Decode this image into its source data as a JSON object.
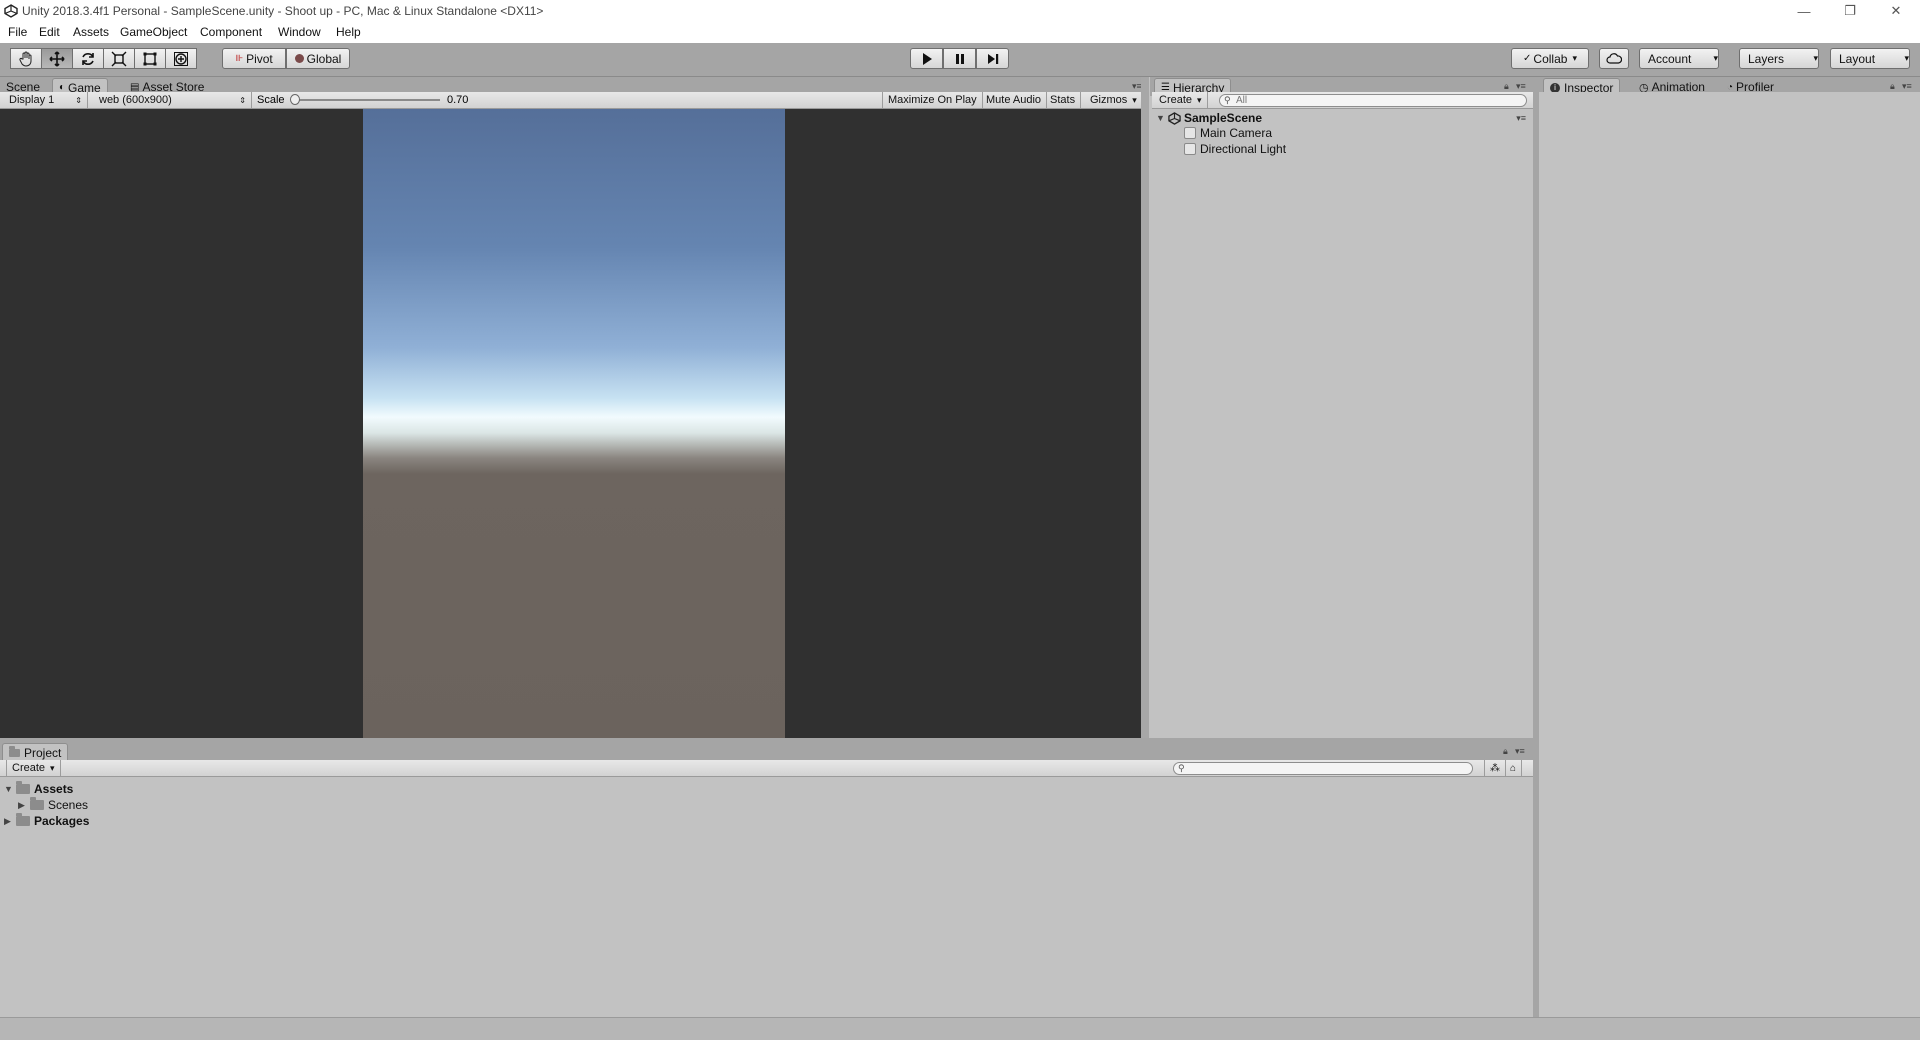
{
  "window": {
    "title": "Unity 2018.3.4f1 Personal - SampleScene.unity - Shoot up - PC, Mac & Linux Standalone <DX11>",
    "minimize": "—",
    "restore": "❐",
    "close": "✕"
  },
  "menu": [
    "File",
    "Edit",
    "Assets",
    "GameObject",
    "Component",
    "Window",
    "Help"
  ],
  "toolbar": {
    "pivot": "Pivot",
    "global": "Global",
    "collab": "Collab",
    "account": "Account",
    "layers": "Layers",
    "layout": "Layout"
  },
  "scene_panel": {
    "tabs": [
      "Scene",
      "Game",
      "Asset Store"
    ],
    "display": "Display 1",
    "resolution": "web (600x900)",
    "scale_label": "Scale",
    "scale_value": "0.70",
    "scale_fraction": 0.0,
    "maximize": "Maximize On Play",
    "mute": "Mute Audio",
    "stats": "Stats",
    "gizmos": "Gizmos"
  },
  "hierarchy": {
    "tab": "Hierarchy",
    "create": "Create",
    "search_placeholder": "All",
    "scene": "SampleScene",
    "items": [
      "Main Camera",
      "Directional Light"
    ]
  },
  "inspector": {
    "tabs": [
      "Inspector",
      "Animation",
      "Profiler"
    ]
  },
  "project": {
    "tab": "Project",
    "create": "Create",
    "root": "Assets",
    "child": "Scenes",
    "packages": "Packages"
  }
}
